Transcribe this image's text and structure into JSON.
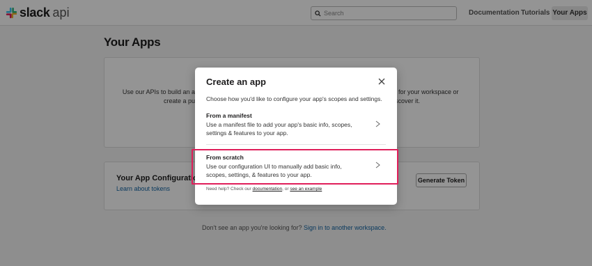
{
  "header": {
    "logo_bold": "slack",
    "logo_light": "api",
    "search_placeholder": "Search",
    "nav": [
      "Documentation",
      "Tutorials",
      "Your Apps"
    ]
  },
  "page": {
    "title": "Your Apps",
    "card1_left_line1": "Use our APIs to build an ap",
    "card1_left_line2": "create a pub",
    "card1_right_line1": "t for your workspace or",
    "card1_right_line2": "scover it.",
    "card2_title": "Your App Configuratio",
    "card2_link": "Learn about tokens",
    "generate_token": "Generate Token",
    "footer_prefix": "Don't see an app you're looking for?",
    "footer_link": "Sign in to another workspace."
  },
  "modal": {
    "title": "Create an app",
    "subtitle": "Choose how you'd like to configure your app's scopes and settings.",
    "options": [
      {
        "title": "From a manifest",
        "desc": "Use a manifest file to add your app's basic info, scopes, settings & features to your app."
      },
      {
        "title": "From scratch",
        "desc": "Use our configuration UI to manually add basic info, scopes, settings, & features to your app."
      }
    ],
    "help_prefix": "Need help? Check our",
    "help_link1": "documentation",
    "help_mid": ", or",
    "help_link2": "see an example"
  },
  "colors": {
    "highlight": "#e01e5a",
    "link": "#1264a3"
  }
}
